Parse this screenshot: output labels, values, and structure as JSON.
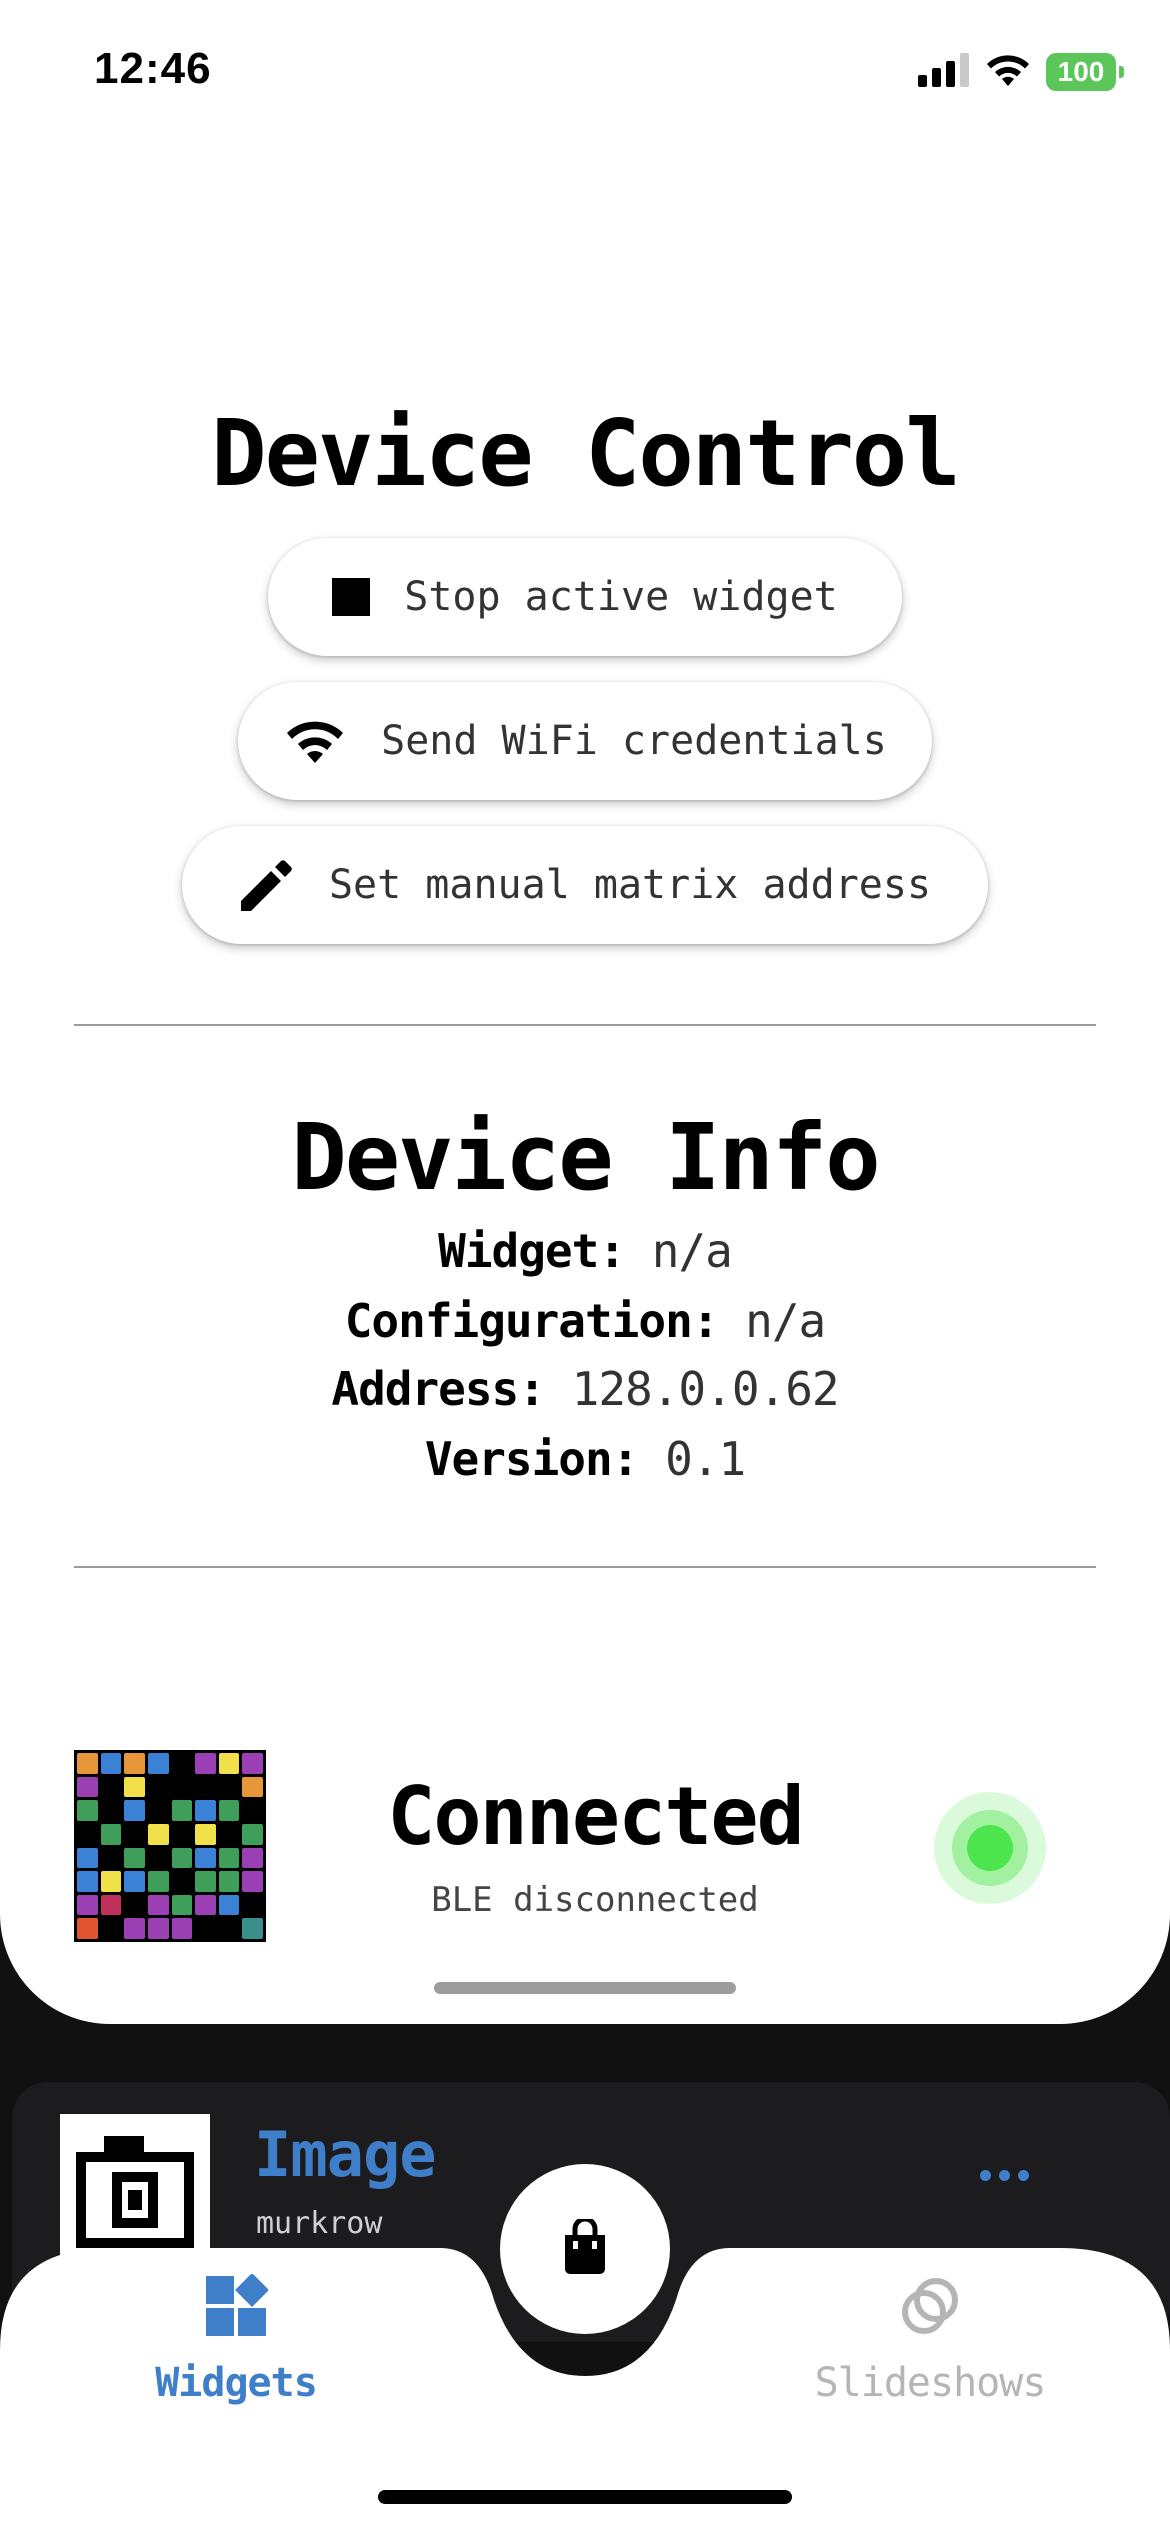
{
  "status_bar": {
    "time": "12:46",
    "battery": "100",
    "icons": [
      "cellular-signal-icon",
      "wifi-icon",
      "battery-icon"
    ]
  },
  "device_control": {
    "title": "Device Control",
    "buttons": [
      {
        "label": "Stop active widget",
        "icon": "stop-icon"
      },
      {
        "label": "Send WiFi credentials",
        "icon": "wifi-icon"
      },
      {
        "label": "Set manual matrix address",
        "icon": "pencil-icon"
      }
    ]
  },
  "device_info": {
    "title": "Device Info",
    "rows": [
      {
        "key": "Widget:",
        "value": "n/a"
      },
      {
        "key": "Configuration:",
        "value": "n/a"
      },
      {
        "key": "Address:",
        "value": "128.0.0.62"
      },
      {
        "key": "Version:",
        "value": "0.1"
      }
    ]
  },
  "connection": {
    "title": "Connected",
    "subtitle": "BLE disconnected",
    "status_color": "#4ce64c",
    "matrix_colors": [
      "#e8963a",
      "#3b82d6",
      "#e8963a",
      "#3b82d6",
      "#000000",
      "#9b3fb5",
      "#f2e04a",
      "#9b3fb5",
      "#9b3fb5",
      "#000000",
      "#f2e04a",
      "#000000",
      "#000000",
      "#000000",
      "#000000",
      "#e8963a",
      "#3f9e5a",
      "#000000",
      "#3b82d6",
      "#000000",
      "#3f9e5a",
      "#3b82d6",
      "#3f9e5a",
      "#000000",
      "#000000",
      "#3f9e5a",
      "#000000",
      "#f2e04a",
      "#000000",
      "#f2e04a",
      "#000000",
      "#3f9e5a",
      "#3b82d6",
      "#000000",
      "#3f9e5a",
      "#000000",
      "#3f9e5a",
      "#3b82d6",
      "#3f9e5a",
      "#9b3fb5",
      "#3b82d6",
      "#f2e04a",
      "#3b82d6",
      "#3f9e5a",
      "#000000",
      "#3f9e5a",
      "#3f9e5a",
      "#9b3fb5",
      "#9b3fb5",
      "#c0305a",
      "#000000",
      "#9b3fb5",
      "#3f9e5a",
      "#9b3fb5",
      "#3b82d6",
      "#000000",
      "#e2552e",
      "#000000",
      "#9b3fb5",
      "#9b3fb5",
      "#9b3fb5",
      "#000000",
      "#000000",
      "#3a8f8a"
    ]
  },
  "widget_card": {
    "title": "Image",
    "subtitle": "murkrow",
    "accent": "#3f7fc9"
  },
  "tab_bar": {
    "tabs": [
      {
        "label": "Widgets",
        "icon": "widgets-icon",
        "active": true
      },
      {
        "label": "Slideshows",
        "icon": "slideshows-icon",
        "active": false
      }
    ],
    "center_icon": "shopping-bag-icon"
  }
}
